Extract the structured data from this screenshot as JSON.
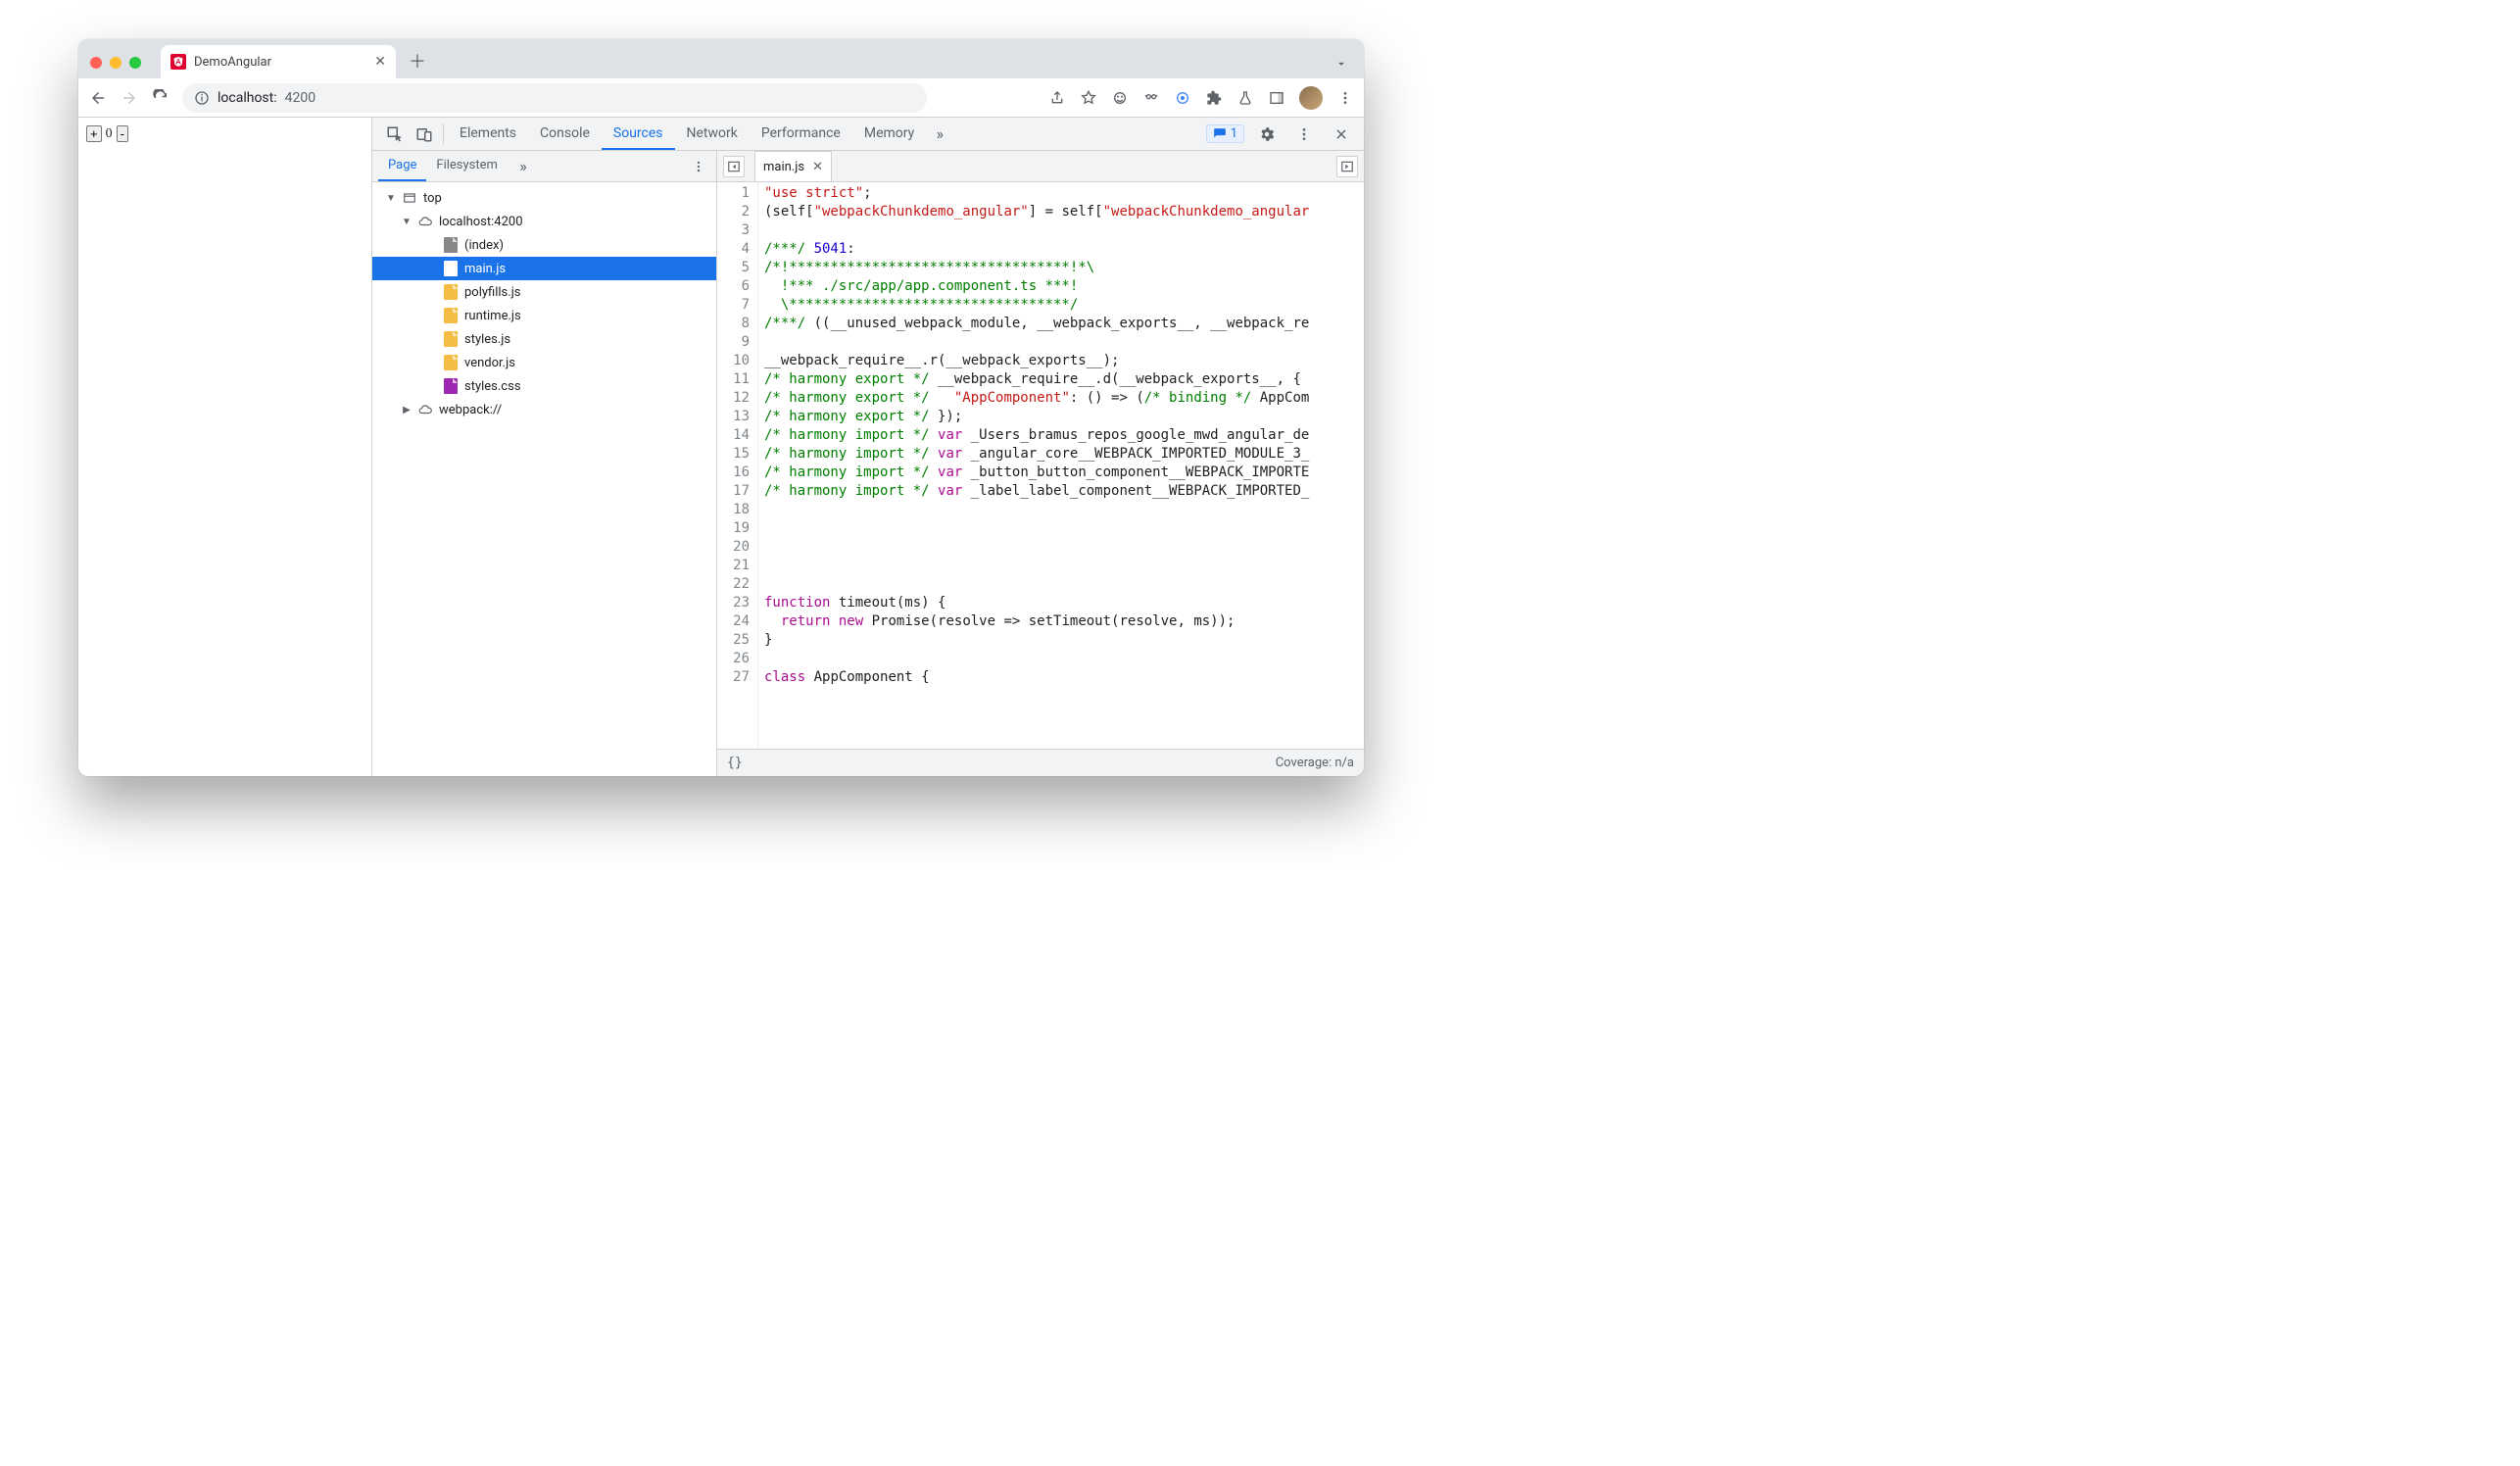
{
  "browser_tab": {
    "title": "DemoAngular"
  },
  "address": {
    "host": "localhost:",
    "port": "4200"
  },
  "page_content": {
    "counter": "0"
  },
  "devtools": {
    "tabs": [
      "Elements",
      "Console",
      "Sources",
      "Network",
      "Performance",
      "Memory"
    ],
    "tabs_active_index": 2,
    "issues_count": "1",
    "navigator": {
      "tabs": [
        "Page",
        "Filesystem"
      ],
      "tabs_active_index": 0,
      "tree": {
        "top": "top",
        "origin": "localhost:4200",
        "files": [
          {
            "name": "(index)",
            "type": "html"
          },
          {
            "name": "main.js",
            "type": "js",
            "selected": true
          },
          {
            "name": "polyfills.js",
            "type": "js"
          },
          {
            "name": "runtime.js",
            "type": "js"
          },
          {
            "name": "styles.js",
            "type": "js"
          },
          {
            "name": "vendor.js",
            "type": "js"
          },
          {
            "name": "styles.css",
            "type": "css"
          }
        ],
        "webpack": "webpack://"
      }
    },
    "editor": {
      "open_file": "main.js",
      "lines": [
        [
          {
            "t": "str",
            "v": "\"use strict\""
          },
          {
            "t": "",
            "v": ";"
          }
        ],
        [
          {
            "t": "",
            "v": "(self["
          },
          {
            "t": "str",
            "v": "\"webpackChunkdemo_angular\""
          },
          {
            "t": "",
            "v": "] = self["
          },
          {
            "t": "str",
            "v": "\"webpackChunkdemo_angular"
          }
        ],
        [],
        [
          {
            "t": "cmt",
            "v": "/***/ "
          },
          {
            "t": "num",
            "v": "5041"
          },
          {
            "t": "",
            "v": ":"
          }
        ],
        [
          {
            "t": "cmt",
            "v": "/*!**********************************!*\\"
          }
        ],
        [
          {
            "t": "cmt",
            "v": "  !*** ./src/app/app.component.ts ***!"
          }
        ],
        [
          {
            "t": "cmt",
            "v": "  \\**********************************/"
          }
        ],
        [
          {
            "t": "cmt",
            "v": "/***/"
          },
          {
            "t": "",
            "v": " ((__unused_webpack_module, __webpack_exports__, __webpack_re"
          }
        ],
        [],
        [
          {
            "t": "",
            "v": "__webpack_require__.r(__webpack_exports__);"
          }
        ],
        [
          {
            "t": "cmt",
            "v": "/* harmony export */"
          },
          {
            "t": "",
            "v": " __webpack_require__.d(__webpack_exports__, {"
          }
        ],
        [
          {
            "t": "cmt",
            "v": "/* harmony export */"
          },
          {
            "t": "",
            "v": "   "
          },
          {
            "t": "str",
            "v": "\"AppComponent\""
          },
          {
            "t": "",
            "v": ": () => ("
          },
          {
            "t": "cmt",
            "v": "/* binding */"
          },
          {
            "t": "",
            "v": " AppCom"
          }
        ],
        [
          {
            "t": "cmt",
            "v": "/* harmony export */"
          },
          {
            "t": "",
            "v": " });"
          }
        ],
        [
          {
            "t": "cmt",
            "v": "/* harmony import */"
          },
          {
            "t": "",
            "v": " "
          },
          {
            "t": "kw",
            "v": "var"
          },
          {
            "t": "",
            "v": " _Users_bramus_repos_google_mwd_angular_de"
          }
        ],
        [
          {
            "t": "cmt",
            "v": "/* harmony import */"
          },
          {
            "t": "",
            "v": " "
          },
          {
            "t": "kw",
            "v": "var"
          },
          {
            "t": "",
            "v": " _angular_core__WEBPACK_IMPORTED_MODULE_3_"
          }
        ],
        [
          {
            "t": "cmt",
            "v": "/* harmony import */"
          },
          {
            "t": "",
            "v": " "
          },
          {
            "t": "kw",
            "v": "var"
          },
          {
            "t": "",
            "v": " _button_button_component__WEBPACK_IMPORTE"
          }
        ],
        [
          {
            "t": "cmt",
            "v": "/* harmony import */"
          },
          {
            "t": "",
            "v": " "
          },
          {
            "t": "kw",
            "v": "var"
          },
          {
            "t": "",
            "v": " _label_label_component__WEBPACK_IMPORTED_"
          }
        ],
        [],
        [],
        [],
        [],
        [],
        [
          {
            "t": "kw",
            "v": "function"
          },
          {
            "t": "",
            "v": " timeout(ms) {"
          }
        ],
        [
          {
            "t": "",
            "v": "  "
          },
          {
            "t": "kw",
            "v": "return"
          },
          {
            "t": "",
            "v": " "
          },
          {
            "t": "kw",
            "v": "new"
          },
          {
            "t": "",
            "v": " Promise(resolve => setTimeout(resolve, ms));"
          }
        ],
        [
          {
            "t": "",
            "v": "}"
          }
        ],
        [],
        [
          {
            "t": "kw",
            "v": "class"
          },
          {
            "t": "",
            "v": " "
          },
          {
            "t": "fn",
            "v": "AppComponent"
          },
          {
            "t": "",
            "v": " {"
          }
        ]
      ]
    },
    "status": {
      "braces": "{}",
      "coverage": "Coverage: n/a"
    }
  }
}
